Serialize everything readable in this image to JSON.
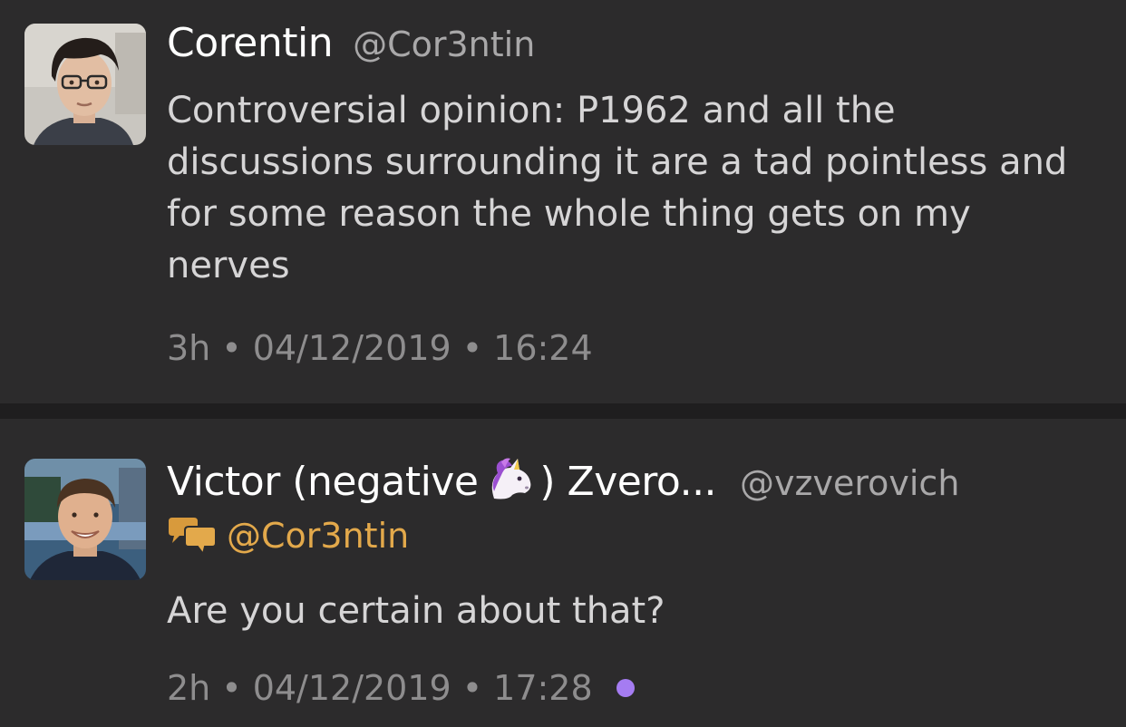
{
  "theme": {
    "background": "#2c2b2c",
    "separator": "#1f1e1f",
    "name_color": "#ffffff",
    "handle_color": "#a9a8a9",
    "text_color": "#d6d5d6",
    "meta_color": "#8e8d8e",
    "reply_accent": "#e3a94b",
    "unread_dot": "#a57cf2"
  },
  "tweets": [
    {
      "display_name": "Corentin",
      "handle": "@Cor3ntin",
      "text": "Controversial opinion: P1962 and all the discussions surrounding it are a tad pointless and for some reason the whole thing gets on my nerves",
      "relative_time": "3h",
      "separator": "•",
      "date": "04/12/2019",
      "time": "16:24",
      "avatar_icon": "avatar-photo"
    },
    {
      "display_name_before": "Victor (negative",
      "display_name_emoji": "unicorn-icon",
      "display_name_after": ") Zvero...",
      "handle": "@vzverovich",
      "reply_icon": "conversation-icon",
      "reply_to": "@Cor3ntin",
      "text": "Are you certain about that?",
      "relative_time": "2h",
      "separator": "•",
      "date": "04/12/2019",
      "time": "17:28",
      "avatar_icon": "avatar-photo",
      "unread": true
    }
  ]
}
